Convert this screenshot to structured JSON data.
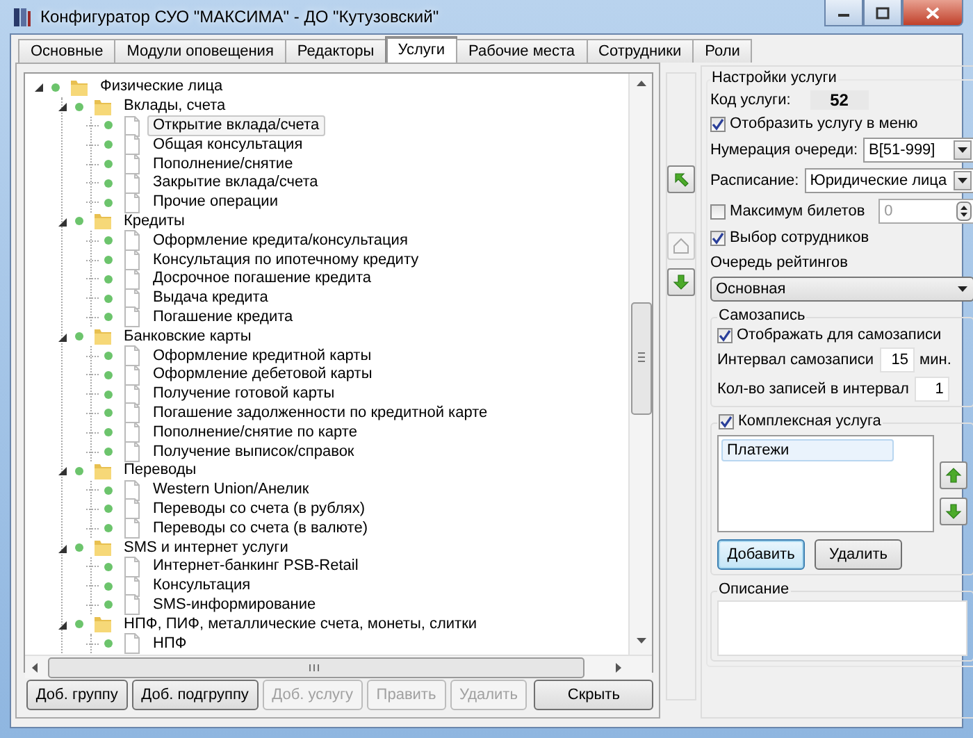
{
  "window": {
    "title": "Конфигуратор СУО \"МАКСИМА\" - ДО \"Кутузовский\""
  },
  "tabs": [
    {
      "label": "Основные",
      "selected": false
    },
    {
      "label": "Модули оповещения",
      "selected": false
    },
    {
      "label": "Редакторы",
      "selected": false
    },
    {
      "label": "Услуги",
      "selected": true
    },
    {
      "label": "Рабочие места",
      "selected": false
    },
    {
      "label": "Сотрудники",
      "selected": false
    },
    {
      "label": "Роли",
      "selected": false
    }
  ],
  "tree": [
    {
      "label": "Физические лица",
      "kind": "folder",
      "expanded": true,
      "selected": false,
      "children": [
        {
          "label": "Вклады, счета",
          "kind": "folder",
          "expanded": true,
          "selected": false,
          "children": [
            {
              "label": "Открытие вклада/счета",
              "kind": "service",
              "selected": true
            },
            {
              "label": "Общая консультация",
              "kind": "service",
              "selected": false
            },
            {
              "label": "Пополнение/снятие",
              "kind": "service",
              "selected": false
            },
            {
              "label": "Закрытие вклада/счета",
              "kind": "service",
              "selected": false
            },
            {
              "label": "Прочие операции",
              "kind": "service",
              "selected": false
            }
          ]
        },
        {
          "label": "Кредиты",
          "kind": "folder",
          "expanded": true,
          "selected": false,
          "children": [
            {
              "label": "Оформление кредита/консультация",
              "kind": "service",
              "selected": false
            },
            {
              "label": "Консультация по ипотечному кредиту",
              "kind": "service",
              "selected": false
            },
            {
              "label": "Досрочное погашение кредита",
              "kind": "service",
              "selected": false
            },
            {
              "label": "Выдача кредита",
              "kind": "service",
              "selected": false
            },
            {
              "label": "Погашение кредита",
              "kind": "service",
              "selected": false
            }
          ]
        },
        {
          "label": "Банковские карты",
          "kind": "folder",
          "expanded": true,
          "selected": false,
          "children": [
            {
              "label": "Оформление кредитной карты",
              "kind": "service",
              "selected": false
            },
            {
              "label": "Оформление дебетовой карты",
              "kind": "service",
              "selected": false
            },
            {
              "label": "Получение готовой карты",
              "kind": "service",
              "selected": false
            },
            {
              "label": "Погашение задолженности по кредитной карте",
              "kind": "service",
              "selected": false
            },
            {
              "label": "Пополнение/снятие по карте",
              "kind": "service",
              "selected": false
            },
            {
              "label": "Получение выписок/справок",
              "kind": "service",
              "selected": false
            }
          ]
        },
        {
          "label": "Переводы",
          "kind": "folder",
          "expanded": true,
          "selected": false,
          "children": [
            {
              "label": "Western Union/Анелик",
              "kind": "service",
              "selected": false
            },
            {
              "label": "Переводы со счета (в рублях)",
              "kind": "service",
              "selected": false
            },
            {
              "label": "Переводы со счета (в валюте)",
              "kind": "service",
              "selected": false
            }
          ]
        },
        {
          "label": "SMS и интернет услуги",
          "kind": "folder",
          "expanded": true,
          "selected": false,
          "children": [
            {
              "label": "Интернет-банкинг PSB-Retail",
              "kind": "service",
              "selected": false
            },
            {
              "label": "Консультация",
              "kind": "service",
              "selected": false
            },
            {
              "label": "SMS-информирование",
              "kind": "service",
              "selected": false
            }
          ]
        },
        {
          "label": "НПФ, ПИФ, металлические счета, монеты, слитки",
          "kind": "folder",
          "expanded": true,
          "selected": false,
          "children": [
            {
              "label": "НПФ",
              "kind": "service",
              "selected": false
            }
          ]
        }
      ]
    }
  ],
  "tree_buttons": [
    {
      "label": "Доб. группу",
      "disabled": false
    },
    {
      "label": "Доб. подгруппу",
      "disabled": false
    },
    {
      "label": "Доб. услугу",
      "disabled": true
    },
    {
      "label": "Править",
      "disabled": true
    },
    {
      "label": "Удалить",
      "disabled": true
    },
    {
      "label": "Скрыть",
      "disabled": false
    }
  ],
  "move_buttons": [
    {
      "kind": "up-left",
      "disabled": false
    },
    {
      "kind": "home",
      "disabled": true
    },
    {
      "kind": "down",
      "disabled": false
    }
  ],
  "settings": {
    "title": "Настройки услуги",
    "code": {
      "label": "Код услуги:",
      "value": "52"
    },
    "show_in_menu": {
      "label": "Отобразить услугу в меню",
      "checked": true
    },
    "numbering": {
      "label": "Нумерация очереди:",
      "value": "B[51-999]"
    },
    "schedule": {
      "label": "Расписание:",
      "value": "Юридические лица"
    },
    "max_tickets": {
      "label": "Максимум билетов",
      "checked": false,
      "value": "0"
    },
    "staff_choice": {
      "label": "Выбор сотрудников",
      "checked": true
    },
    "rating_queue": {
      "label": "Очередь рейтингов",
      "value": "Основная"
    },
    "self_booking": {
      "title": "Самозапись",
      "show": {
        "label": "Отображать для самозаписи",
        "checked": true
      },
      "interval": {
        "label": "Интервал самозаписи",
        "value": "15",
        "unit": "мин."
      },
      "per_interval": {
        "label": "Кол-во записей в интервал",
        "value": "1"
      }
    },
    "complex": {
      "label": "Комплексная услуга",
      "checked": true,
      "items": [
        {
          "label": "Платежи",
          "selected": true
        }
      ],
      "buttons": [
        {
          "label": "Добавить",
          "focused": true
        },
        {
          "label": "Удалить",
          "focused": false
        }
      ]
    },
    "description": {
      "title": "Описание"
    }
  }
}
